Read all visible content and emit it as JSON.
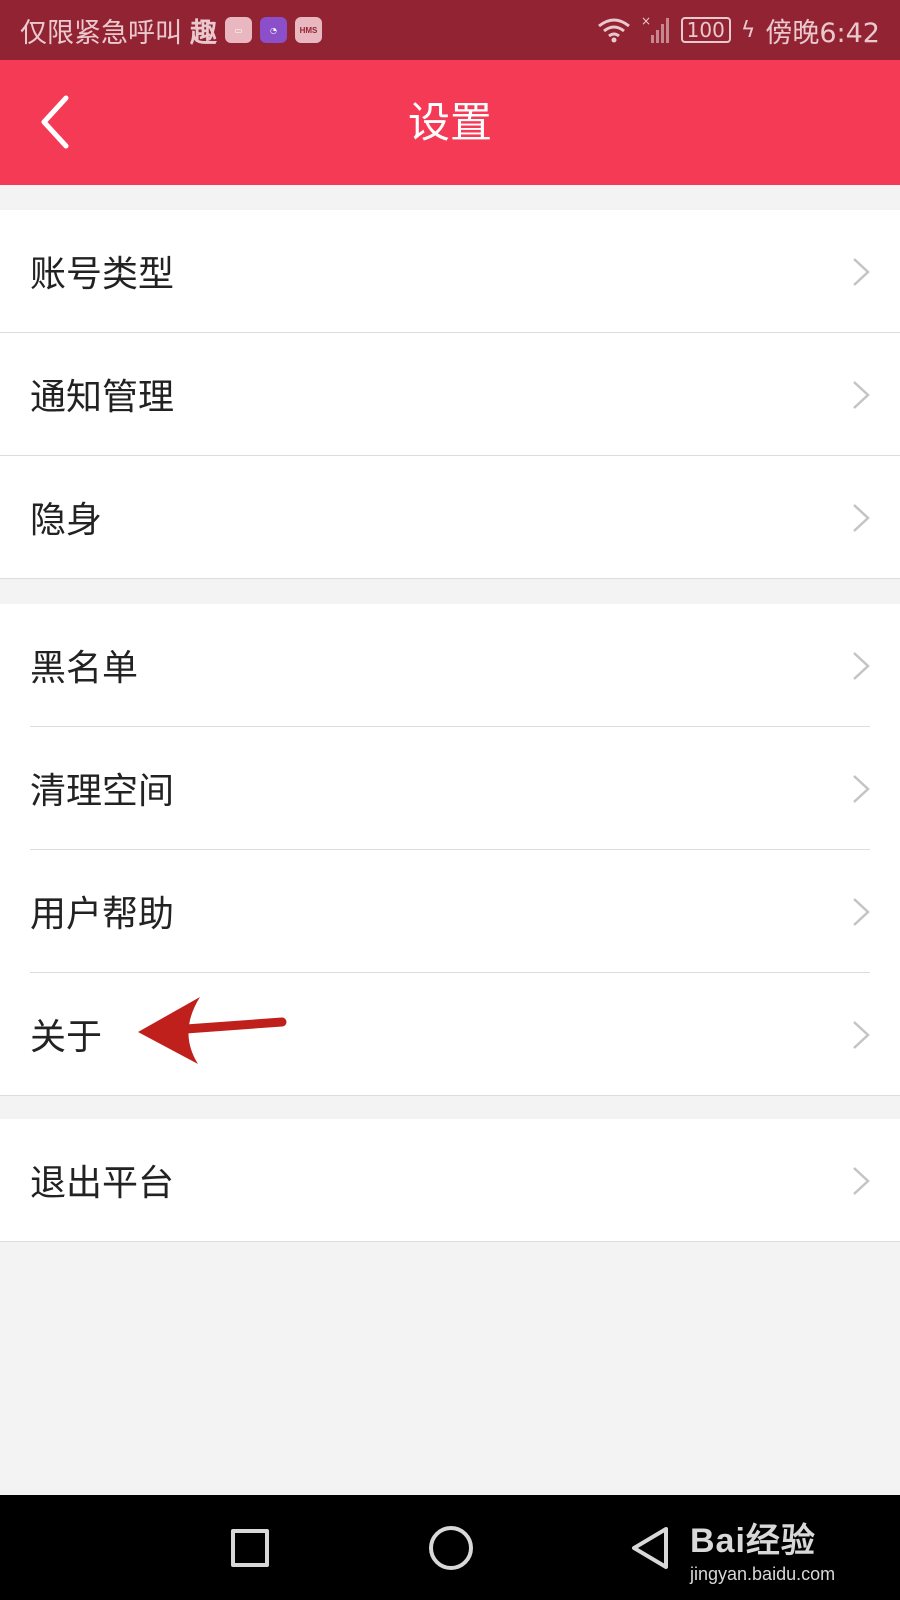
{
  "status_bar": {
    "left_text": "仅限紧急呼叫",
    "app_badge": "趣",
    "hms_label": "HMS",
    "battery": "100",
    "time": "傍晚6:42"
  },
  "header": {
    "title": "设置",
    "back_icon": "chevron-left-icon"
  },
  "groups": [
    {
      "items": [
        {
          "label": "账号类型"
        },
        {
          "label": "通知管理"
        },
        {
          "label": "隐身"
        }
      ]
    },
    {
      "items": [
        {
          "label": "黑名单"
        },
        {
          "label": "清理空间"
        },
        {
          "label": "用户帮助"
        },
        {
          "label": "关于"
        }
      ]
    },
    {
      "items": [
        {
          "label": "退出平台"
        }
      ]
    }
  ],
  "nav_bar": {
    "watermark_brand": "Bai经验",
    "watermark_url": "jingyan.baidu.com"
  },
  "colors": {
    "status_bar": "#922333",
    "header": "#f43a55",
    "background": "#f3f3f3",
    "annotation_arrow": "#c0201c"
  }
}
